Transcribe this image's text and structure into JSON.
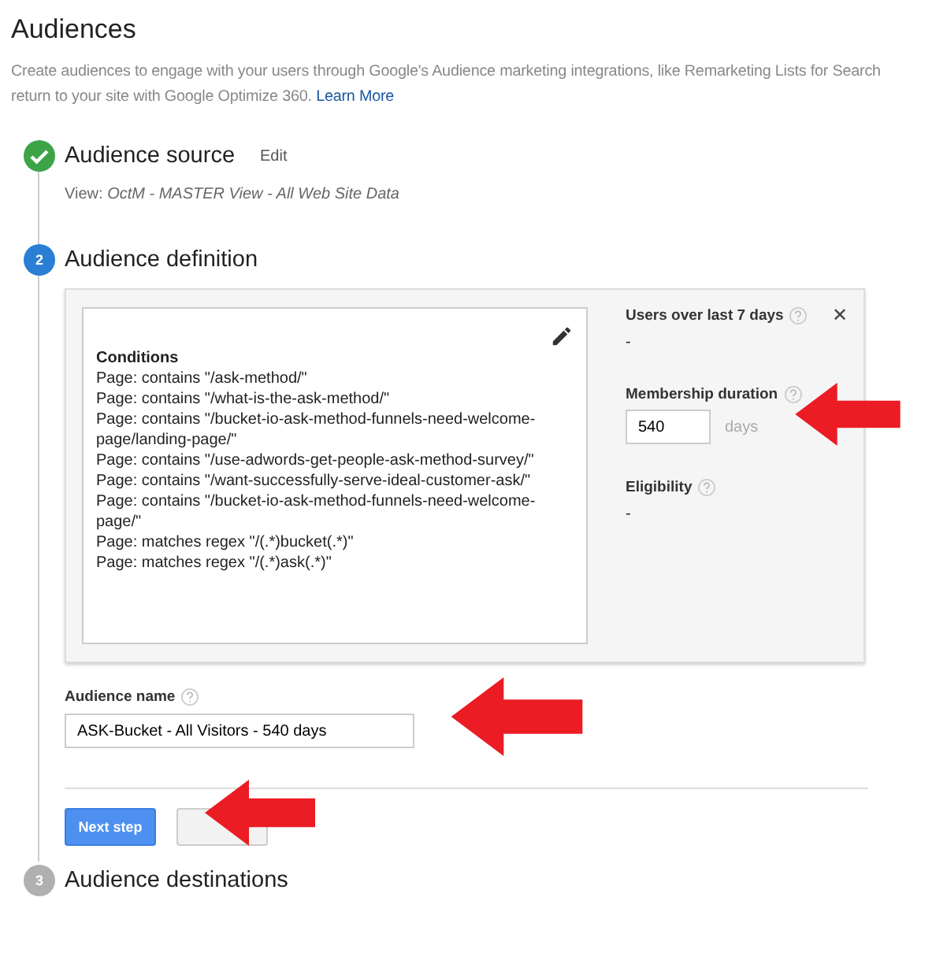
{
  "title": "Audiences",
  "description": {
    "text": "Create audiences to engage with your users through Google's Audience marketing integrations, like Remarketing Lists for Search",
    "text2": "return to your site with Google Optimize 360.",
    "link": "Learn More"
  },
  "steps": [
    {
      "kind": "done",
      "title": "Audience source",
      "edit": "Edit",
      "view_label": "View:",
      "view_value": "OctM - MASTER View - All Web Site Data"
    },
    {
      "kind": "current",
      "number": "2",
      "title": "Audience definition"
    },
    {
      "kind": "pending",
      "number": "3",
      "title": "Audience destinations"
    }
  ],
  "definition": {
    "conditions_title": "Conditions",
    "conditions": [
      "Page: contains \"/ask-method/\"",
      "Page: contains \"/what-is-the-ask-method/\"",
      "Page: contains \"/bucket-io-ask-method-funnels-need-welcome-page/landing-page/\"",
      "Page: contains \"/use-adwords-get-people-ask-method-survey/\"",
      "Page: contains \"/want-successfully-serve-ideal-customer-ask/\"",
      "Page: contains \"/bucket-io-ask-method-funnels-need-welcome-page/\"",
      "Page: matches regex \"/(.*)bucket(.*)\"",
      "Page: matches regex \"/(.*)ask(.*)\""
    ],
    "users_label": "Users over last 7 days",
    "users_value": "-",
    "duration_label": "Membership duration",
    "duration_value": "540",
    "duration_unit": "days",
    "eligibility_label": "Eligibility",
    "eligibility_value": "-",
    "close": "✕"
  },
  "audience_name": {
    "label": "Audience name",
    "value": "ASK-Bucket - All Visitors - 540 days"
  },
  "next_button": "Next step"
}
